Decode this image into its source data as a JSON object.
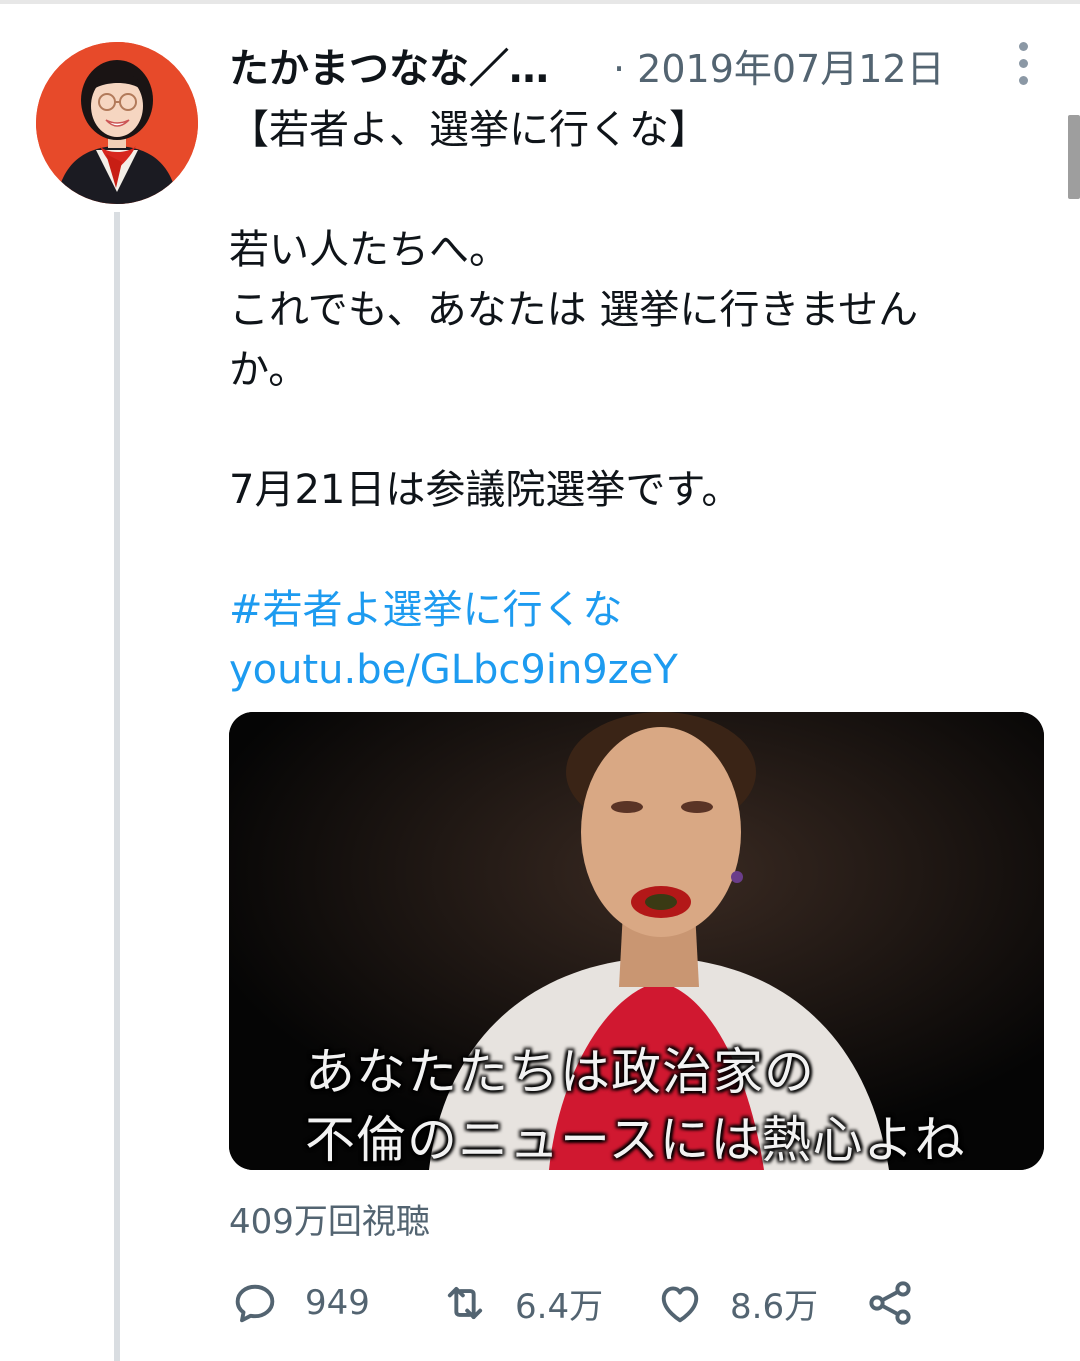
{
  "tweet": {
    "display_name": "たかまつなな／…",
    "date": "· 2019年07月12日",
    "lines": [
      "【若者よ、選挙に行くな】",
      "若い人たちへ。",
      "これでも、あなたは 選挙に行きません",
      "か。",
      "7月21日は参議院選挙です。"
    ],
    "hashtag": "#若者よ選挙に行くな",
    "link": "youtu.be/GLbc9in9zeY"
  },
  "media": {
    "subtitle_line1": "あなたたちは政治家の",
    "subtitle_line2": "不倫のニュースには熱心よね"
  },
  "stats": {
    "views": "409万回視聴"
  },
  "actions": {
    "reply_count": "949",
    "retweet_count": "6.4万",
    "like_count": "8.6万"
  },
  "icons": {
    "reply": "reply-icon",
    "retweet": "retweet-icon",
    "like": "heart-icon",
    "share": "share-icon",
    "more": "more-vertical-icon"
  },
  "colors": {
    "link": "#1d9bf0",
    "secondary_text": "#536471",
    "avatar_bg": "#e74a2a"
  }
}
